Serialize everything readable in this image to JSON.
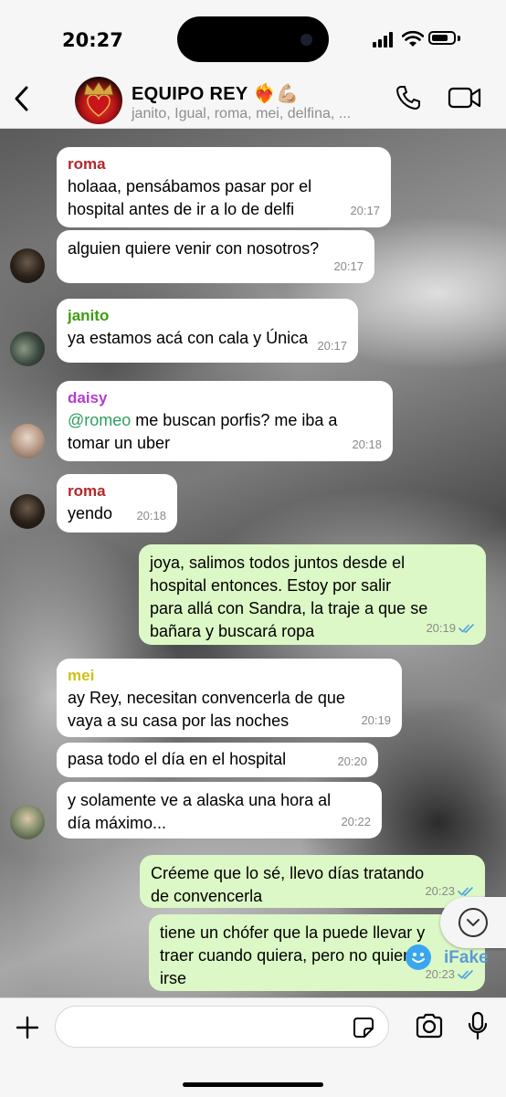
{
  "status_bar": {
    "time": "20:27"
  },
  "header": {
    "title": "EQUIPO REY",
    "title_emoji": "❤️‍🔥💪🏼",
    "members": "janito, Igual, roma, mei, delfina, ..."
  },
  "messages": [
    {
      "sender": "roma",
      "text": "holaaa, pensábamos pasar por el\nhospital antes de ir a lo de delfi",
      "time": "20:17"
    },
    {
      "text": "alguien quiere venir con nosotros?",
      "time": "20:17"
    },
    {
      "sender": "janito",
      "text": "ya estamos acá con cala y Única",
      "time": "20:17"
    },
    {
      "sender": "daisy",
      "mention": "@romeo",
      "text": " me buscan porfis? me iba a\ntomar un uber",
      "time": "20:18"
    },
    {
      "sender": "roma",
      "text": "yendo",
      "time": "20:18"
    },
    {
      "text": "joya, salimos todos juntos desde el\nhospital entonces. Estoy por salir\npara allá con Sandra, la traje a que se\nbañara y buscará ropa",
      "time": "20:19"
    },
    {
      "sender": "mei",
      "text": "ay Rey, necesitan convencerla de que\nvaya a su casa por las noches",
      "time": "20:19"
    },
    {
      "text": "pasa todo el día en el hospital",
      "time": "20:20"
    },
    {
      "text": "y solamente ve a alaska una hora al\ndía máximo...",
      "time": "20:22"
    },
    {
      "text": "Créeme que lo sé, llevo días tratando\nde convencerla",
      "time": "20:23"
    },
    {
      "text": "tiene un chófer que la puede llevar y\ntraer cuando quiera, pero no quiere\nirse",
      "time": "20:23"
    }
  ],
  "watermark": "iFake",
  "colors": {
    "roma": "#b2282a",
    "janito": "#3f9b12",
    "daisy": "#b43bd1",
    "mei": "#cfc019",
    "mention": "#2c9e5e",
    "outgoing_bubble": "#dcf8c6",
    "ticks": "#4fa3e0"
  },
  "icons": [
    "back-chevron-icon",
    "phone-icon",
    "video-camera-icon",
    "plus-icon",
    "sticker-icon",
    "camera-icon",
    "microphone-icon",
    "scroll-down-icon"
  ]
}
